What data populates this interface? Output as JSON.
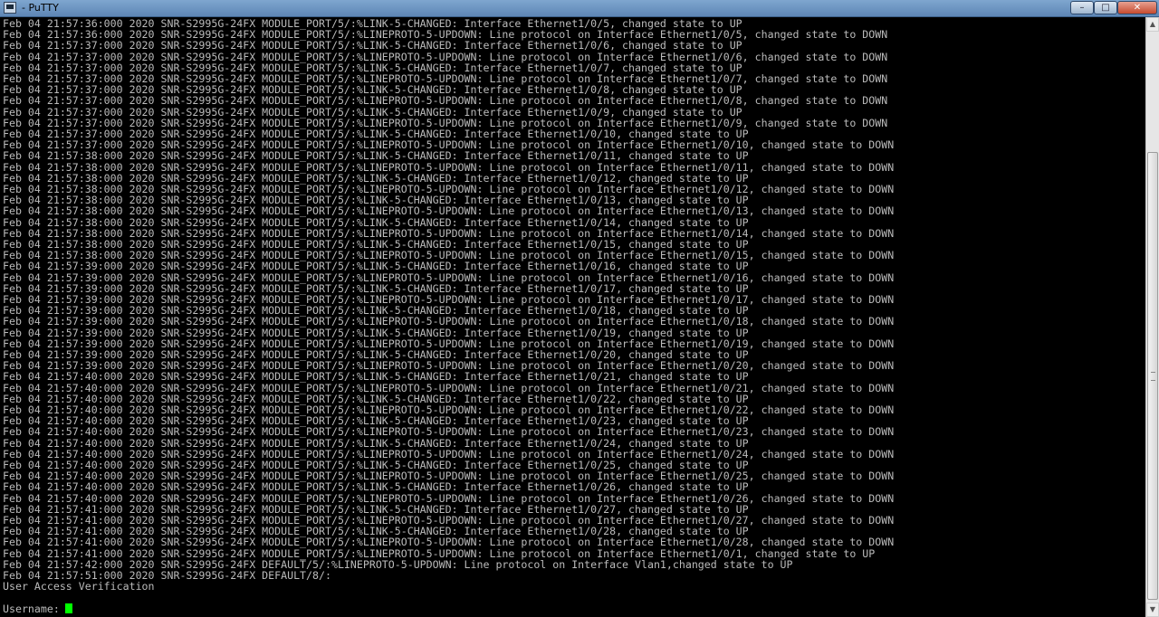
{
  "window": {
    "title": "- PuTTY",
    "minimize": "–",
    "maximize": "□",
    "close": "✕"
  },
  "terminal": {
    "lines": [
      "Feb 04 21:57:36:000 2020 SNR-S2995G-24FX MODULE_PORT/5/:%LINK-5-CHANGED: Interface Ethernet1/0/5, changed state to UP",
      "Feb 04 21:57:36:000 2020 SNR-S2995G-24FX MODULE_PORT/5/:%LINEPROTO-5-UPDOWN: Line protocol on Interface Ethernet1/0/5, changed state to DOWN",
      "Feb 04 21:57:37:000 2020 SNR-S2995G-24FX MODULE_PORT/5/:%LINK-5-CHANGED: Interface Ethernet1/0/6, changed state to UP",
      "Feb 04 21:57:37:000 2020 SNR-S2995G-24FX MODULE_PORT/5/:%LINEPROTO-5-UPDOWN: Line protocol on Interface Ethernet1/0/6, changed state to DOWN",
      "Feb 04 21:57:37:000 2020 SNR-S2995G-24FX MODULE_PORT/5/:%LINK-5-CHANGED: Interface Ethernet1/0/7, changed state to UP",
      "Feb 04 21:57:37:000 2020 SNR-S2995G-24FX MODULE_PORT/5/:%LINEPROTO-5-UPDOWN: Line protocol on Interface Ethernet1/0/7, changed state to DOWN",
      "Feb 04 21:57:37:000 2020 SNR-S2995G-24FX MODULE_PORT/5/:%LINK-5-CHANGED: Interface Ethernet1/0/8, changed state to UP",
      "Feb 04 21:57:37:000 2020 SNR-S2995G-24FX MODULE_PORT/5/:%LINEPROTO-5-UPDOWN: Line protocol on Interface Ethernet1/0/8, changed state to DOWN",
      "Feb 04 21:57:37:000 2020 SNR-S2995G-24FX MODULE_PORT/5/:%LINK-5-CHANGED: Interface Ethernet1/0/9, changed state to UP",
      "Feb 04 21:57:37:000 2020 SNR-S2995G-24FX MODULE_PORT/5/:%LINEPROTO-5-UPDOWN: Line protocol on Interface Ethernet1/0/9, changed state to DOWN",
      "Feb 04 21:57:37:000 2020 SNR-S2995G-24FX MODULE_PORT/5/:%LINK-5-CHANGED: Interface Ethernet1/0/10, changed state to UP",
      "Feb 04 21:57:37:000 2020 SNR-S2995G-24FX MODULE_PORT/5/:%LINEPROTO-5-UPDOWN: Line protocol on Interface Ethernet1/0/10, changed state to DOWN",
      "Feb 04 21:57:38:000 2020 SNR-S2995G-24FX MODULE_PORT/5/:%LINK-5-CHANGED: Interface Ethernet1/0/11, changed state to UP",
      "Feb 04 21:57:38:000 2020 SNR-S2995G-24FX MODULE_PORT/5/:%LINEPROTO-5-UPDOWN: Line protocol on Interface Ethernet1/0/11, changed state to DOWN",
      "Feb 04 21:57:38:000 2020 SNR-S2995G-24FX MODULE_PORT/5/:%LINK-5-CHANGED: Interface Ethernet1/0/12, changed state to UP",
      "Feb 04 21:57:38:000 2020 SNR-S2995G-24FX MODULE_PORT/5/:%LINEPROTO-5-UPDOWN: Line protocol on Interface Ethernet1/0/12, changed state to DOWN",
      "Feb 04 21:57:38:000 2020 SNR-S2995G-24FX MODULE_PORT/5/:%LINK-5-CHANGED: Interface Ethernet1/0/13, changed state to UP",
      "Feb 04 21:57:38:000 2020 SNR-S2995G-24FX MODULE_PORT/5/:%LINEPROTO-5-UPDOWN: Line protocol on Interface Ethernet1/0/13, changed state to DOWN",
      "Feb 04 21:57:38:000 2020 SNR-S2995G-24FX MODULE_PORT/5/:%LINK-5-CHANGED: Interface Ethernet1/0/14, changed state to UP",
      "Feb 04 21:57:38:000 2020 SNR-S2995G-24FX MODULE_PORT/5/:%LINEPROTO-5-UPDOWN: Line protocol on Interface Ethernet1/0/14, changed state to DOWN",
      "Feb 04 21:57:38:000 2020 SNR-S2995G-24FX MODULE_PORT/5/:%LINK-5-CHANGED: Interface Ethernet1/0/15, changed state to UP",
      "Feb 04 21:57:38:000 2020 SNR-S2995G-24FX MODULE_PORT/5/:%LINEPROTO-5-UPDOWN: Line protocol on Interface Ethernet1/0/15, changed state to DOWN",
      "Feb 04 21:57:39:000 2020 SNR-S2995G-24FX MODULE_PORT/5/:%LINK-5-CHANGED: Interface Ethernet1/0/16, changed state to UP",
      "Feb 04 21:57:39:000 2020 SNR-S2995G-24FX MODULE_PORT/5/:%LINEPROTO-5-UPDOWN: Line protocol on Interface Ethernet1/0/16, changed state to DOWN",
      "Feb 04 21:57:39:000 2020 SNR-S2995G-24FX MODULE_PORT/5/:%LINK-5-CHANGED: Interface Ethernet1/0/17, changed state to UP",
      "Feb 04 21:57:39:000 2020 SNR-S2995G-24FX MODULE_PORT/5/:%LINEPROTO-5-UPDOWN: Line protocol on Interface Ethernet1/0/17, changed state to DOWN",
      "Feb 04 21:57:39:000 2020 SNR-S2995G-24FX MODULE_PORT/5/:%LINK-5-CHANGED: Interface Ethernet1/0/18, changed state to UP",
      "Feb 04 21:57:39:000 2020 SNR-S2995G-24FX MODULE_PORT/5/:%LINEPROTO-5-UPDOWN: Line protocol on Interface Ethernet1/0/18, changed state to DOWN",
      "Feb 04 21:57:39:000 2020 SNR-S2995G-24FX MODULE_PORT/5/:%LINK-5-CHANGED: Interface Ethernet1/0/19, changed state to UP",
      "Feb 04 21:57:39:000 2020 SNR-S2995G-24FX MODULE_PORT/5/:%LINEPROTO-5-UPDOWN: Line protocol on Interface Ethernet1/0/19, changed state to DOWN",
      "Feb 04 21:57:39:000 2020 SNR-S2995G-24FX MODULE_PORT/5/:%LINK-5-CHANGED: Interface Ethernet1/0/20, changed state to UP",
      "Feb 04 21:57:39:000 2020 SNR-S2995G-24FX MODULE_PORT/5/:%LINEPROTO-5-UPDOWN: Line protocol on Interface Ethernet1/0/20, changed state to DOWN",
      "Feb 04 21:57:40:000 2020 SNR-S2995G-24FX MODULE_PORT/5/:%LINK-5-CHANGED: Interface Ethernet1/0/21, changed state to UP",
      "Feb 04 21:57:40:000 2020 SNR-S2995G-24FX MODULE_PORT/5/:%LINEPROTO-5-UPDOWN: Line protocol on Interface Ethernet1/0/21, changed state to DOWN",
      "Feb 04 21:57:40:000 2020 SNR-S2995G-24FX MODULE_PORT/5/:%LINK-5-CHANGED: Interface Ethernet1/0/22, changed state to UP",
      "Feb 04 21:57:40:000 2020 SNR-S2995G-24FX MODULE_PORT/5/:%LINEPROTO-5-UPDOWN: Line protocol on Interface Ethernet1/0/22, changed state to DOWN",
      "Feb 04 21:57:40:000 2020 SNR-S2995G-24FX MODULE_PORT/5/:%LINK-5-CHANGED: Interface Ethernet1/0/23, changed state to UP",
      "Feb 04 21:57:40:000 2020 SNR-S2995G-24FX MODULE_PORT/5/:%LINEPROTO-5-UPDOWN: Line protocol on Interface Ethernet1/0/23, changed state to DOWN",
      "Feb 04 21:57:40:000 2020 SNR-S2995G-24FX MODULE_PORT/5/:%LINK-5-CHANGED: Interface Ethernet1/0/24, changed state to UP",
      "Feb 04 21:57:40:000 2020 SNR-S2995G-24FX MODULE_PORT/5/:%LINEPROTO-5-UPDOWN: Line protocol on Interface Ethernet1/0/24, changed state to DOWN",
      "Feb 04 21:57:40:000 2020 SNR-S2995G-24FX MODULE_PORT/5/:%LINK-5-CHANGED: Interface Ethernet1/0/25, changed state to UP",
      "Feb 04 21:57:40:000 2020 SNR-S2995G-24FX MODULE_PORT/5/:%LINEPROTO-5-UPDOWN: Line protocol on Interface Ethernet1/0/25, changed state to DOWN",
      "Feb 04 21:57:40:000 2020 SNR-S2995G-24FX MODULE_PORT/5/:%LINK-5-CHANGED: Interface Ethernet1/0/26, changed state to UP",
      "Feb 04 21:57:40:000 2020 SNR-S2995G-24FX MODULE_PORT/5/:%LINEPROTO-5-UPDOWN: Line protocol on Interface Ethernet1/0/26, changed state to DOWN",
      "Feb 04 21:57:41:000 2020 SNR-S2995G-24FX MODULE_PORT/5/:%LINK-5-CHANGED: Interface Ethernet1/0/27, changed state to UP",
      "Feb 04 21:57:41:000 2020 SNR-S2995G-24FX MODULE_PORT/5/:%LINEPROTO-5-UPDOWN: Line protocol on Interface Ethernet1/0/27, changed state to DOWN",
      "Feb 04 21:57:41:000 2020 SNR-S2995G-24FX MODULE_PORT/5/:%LINK-5-CHANGED: Interface Ethernet1/0/28, changed state to UP",
      "Feb 04 21:57:41:000 2020 SNR-S2995G-24FX MODULE_PORT/5/:%LINEPROTO-5-UPDOWN: Line protocol on Interface Ethernet1/0/28, changed state to DOWN",
      "Feb 04 21:57:41:000 2020 SNR-S2995G-24FX MODULE_PORT/5/:%LINEPROTO-5-UPDOWN: Line protocol on Interface Ethernet1/0/1, changed state to UP",
      "Feb 04 21:57:42:000 2020 SNR-S2995G-24FX DEFAULT/5/:%LINEPROTO-5-UPDOWN: Line protocol on Interface Vlan1,changed state to UP",
      "Feb 04 21:57:51:000 2020 SNR-S2995G-24FX DEFAULT/8/:",
      "User Access Verification",
      ""
    ],
    "prompt_label": "Username:",
    "text_color": "#bbbbbb",
    "cursor_color": "#00ff00",
    "background_color": "#000000"
  },
  "scrollbar": {
    "up_arrow": "▲",
    "down_arrow": "▼",
    "position_fraction": 1.0
  }
}
